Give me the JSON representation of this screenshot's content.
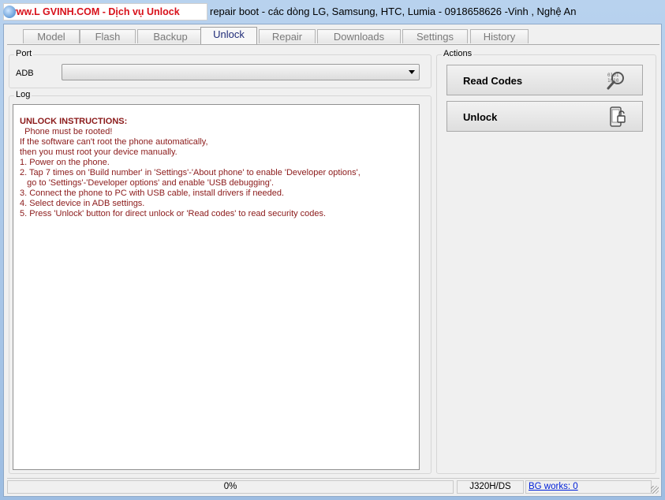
{
  "titlebar": {
    "highlight": "www.L GVINH.COM -  Dịch vụ Unlock",
    "rest": "repair boot - các dòng LG, Samsung, HTC, Lumia - 0918658626 -Vinh , Nghệ An"
  },
  "tabs": [
    {
      "label": "Model",
      "active": false
    },
    {
      "label": "Flash",
      "active": false
    },
    {
      "label": "Backup",
      "active": false
    },
    {
      "label": "Unlock",
      "active": true
    },
    {
      "label": "Repair",
      "active": false
    },
    {
      "label": "Downloads",
      "active": false
    },
    {
      "label": "Settings",
      "active": false
    },
    {
      "label": "History",
      "active": false
    }
  ],
  "port": {
    "group_label": "Port",
    "field_label": "ADB",
    "selected": ""
  },
  "log": {
    "group_label": "Log",
    "lines": [
      "UNLOCK INSTRUCTIONS:",
      "  Phone must be rooted!",
      "If the software can't root the phone automatically,",
      "then you must root your device manually.",
      "1. Power on the phone.",
      "2. Tap 7 times on 'Build number' in 'Settings'-'About phone' to enable 'Developer options',",
      "   go to 'Settings'-'Developer options' and enable 'USB debugging'.",
      "3. Connect the phone to PC with USB cable, install drivers if needed.",
      "4. Select device in ADB settings.",
      "5. Press 'Unlock' button for direct unlock or 'Read codes' to read security codes."
    ]
  },
  "actions": {
    "group_label": "Actions",
    "read_codes_label": "Read Codes",
    "read_codes_icon": "magnifier-binary-icon",
    "unlock_label": "Unlock",
    "unlock_icon": "phone-unlock-icon"
  },
  "status": {
    "progress_text": "0%",
    "progress_fraction": 0,
    "model": "J320H/DS",
    "bg_works": "BG works: 0"
  },
  "colors": {
    "title_highlight": "#d8101a",
    "log_text": "#8b1a1a",
    "active_tab_text": "#1f2b78",
    "link": "#0020d8"
  }
}
